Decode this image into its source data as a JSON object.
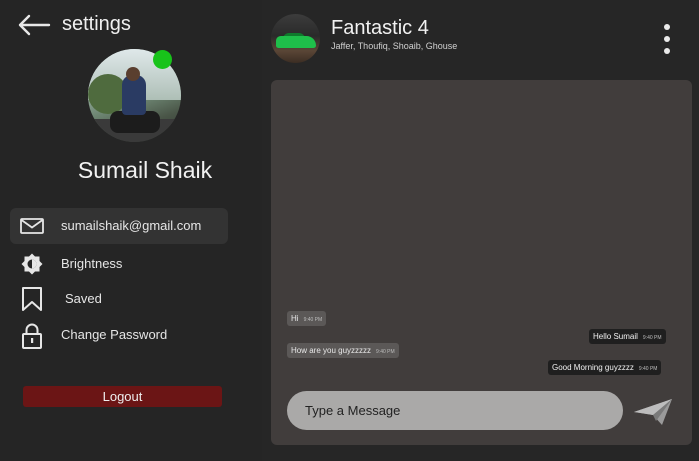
{
  "settings": {
    "title": "settings",
    "user_name": "Sumail Shaik",
    "online_status_color": "#18c31a",
    "menu": [
      {
        "icon": "mail-icon",
        "label": "sumailshaik@gmail.com"
      },
      {
        "icon": "brightness-icon",
        "label": "Brightness"
      },
      {
        "icon": "bookmark-icon",
        "label": "Saved"
      },
      {
        "icon": "lock-icon",
        "label": "Change Password"
      }
    ],
    "logout_label": "Logout",
    "logout_color": "#6b1515"
  },
  "chat": {
    "group_name": "Fantastic 4",
    "members": "Jaffer, Thoufiq, Shoaib, Ghouse",
    "messages": [
      {
        "direction": "in",
        "text": "Hi",
        "time": "9:40 PM"
      },
      {
        "direction": "out",
        "text": "Hello Sumail",
        "time": "9:40 PM"
      },
      {
        "direction": "in",
        "text": "How are you guyzzzzz",
        "time": "9:40 PM"
      },
      {
        "direction": "out",
        "text": "Good Morning guyzzzz",
        "time": "9:40 PM"
      }
    ],
    "input_placeholder": "Type a Message"
  }
}
